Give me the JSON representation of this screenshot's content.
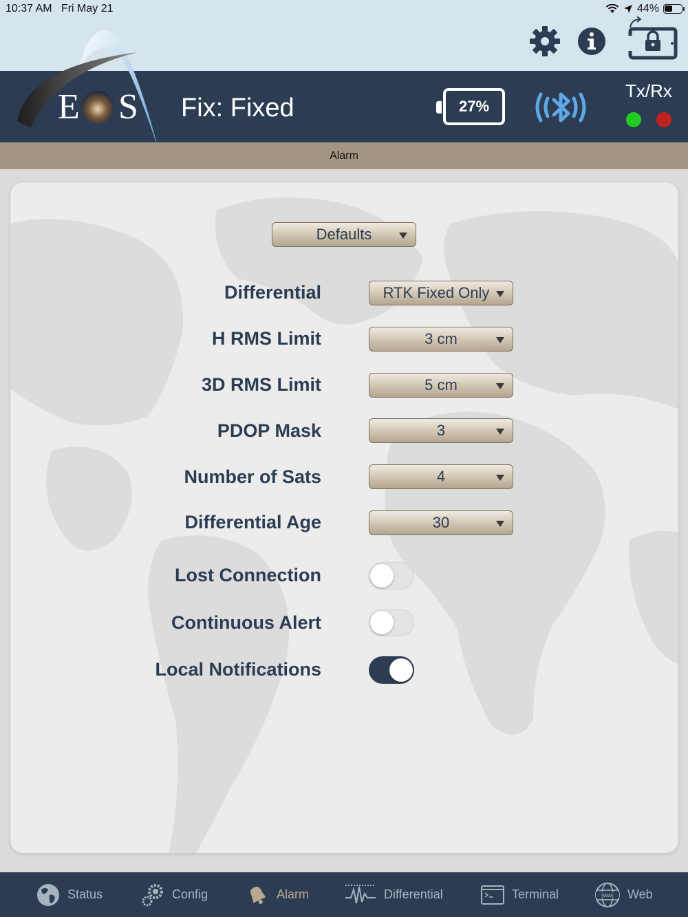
{
  "status_bar": {
    "time": "10:37 AM",
    "date": "Fri May 21",
    "battery": "44%"
  },
  "header": {
    "logo_text": "EOS",
    "fix": "Fix: Fixed",
    "battery_percent": "27%",
    "txrx_label": "Tx/Rx",
    "tx_color": "#22cc22",
    "rx_color": "#c0221f",
    "icons": [
      "gear-icon",
      "info-icon",
      "rotation-lock-icon",
      "bluetooth-icon"
    ]
  },
  "page_title": "Alarm",
  "form": {
    "preset": "Defaults",
    "rows": [
      {
        "label": "Differential",
        "value": "RTK Fixed Only"
      },
      {
        "label": "H RMS Limit",
        "value": "3 cm"
      },
      {
        "label": "3D RMS Limit",
        "value": "5 cm"
      },
      {
        "label": "PDOP Mask",
        "value": "3"
      },
      {
        "label": "Number of Sats",
        "value": "4"
      },
      {
        "label": "Differential Age",
        "value": "30"
      }
    ],
    "toggles": [
      {
        "label": "Lost Connection",
        "on": false
      },
      {
        "label": "Continuous Alert",
        "on": false
      },
      {
        "label": "Local Notifications",
        "on": true
      }
    ]
  },
  "tabs": [
    {
      "label": "Status",
      "icon": "globe-icon",
      "active": false
    },
    {
      "label": "Config",
      "icon": "gears-icon",
      "active": false
    },
    {
      "label": "Alarm",
      "icon": "bell-icon",
      "active": true
    },
    {
      "label": "Differential",
      "icon": "waveform-icon",
      "active": false
    },
    {
      "label": "Terminal",
      "icon": "terminal-icon",
      "active": false
    },
    {
      "label": "Web",
      "icon": "www-globe-icon",
      "active": false
    }
  ],
  "colors": {
    "navy": "#2c3d53",
    "tan": "#a49682",
    "active_tab": "#b9a88c",
    "bluetooth": "#5fa8e8"
  }
}
